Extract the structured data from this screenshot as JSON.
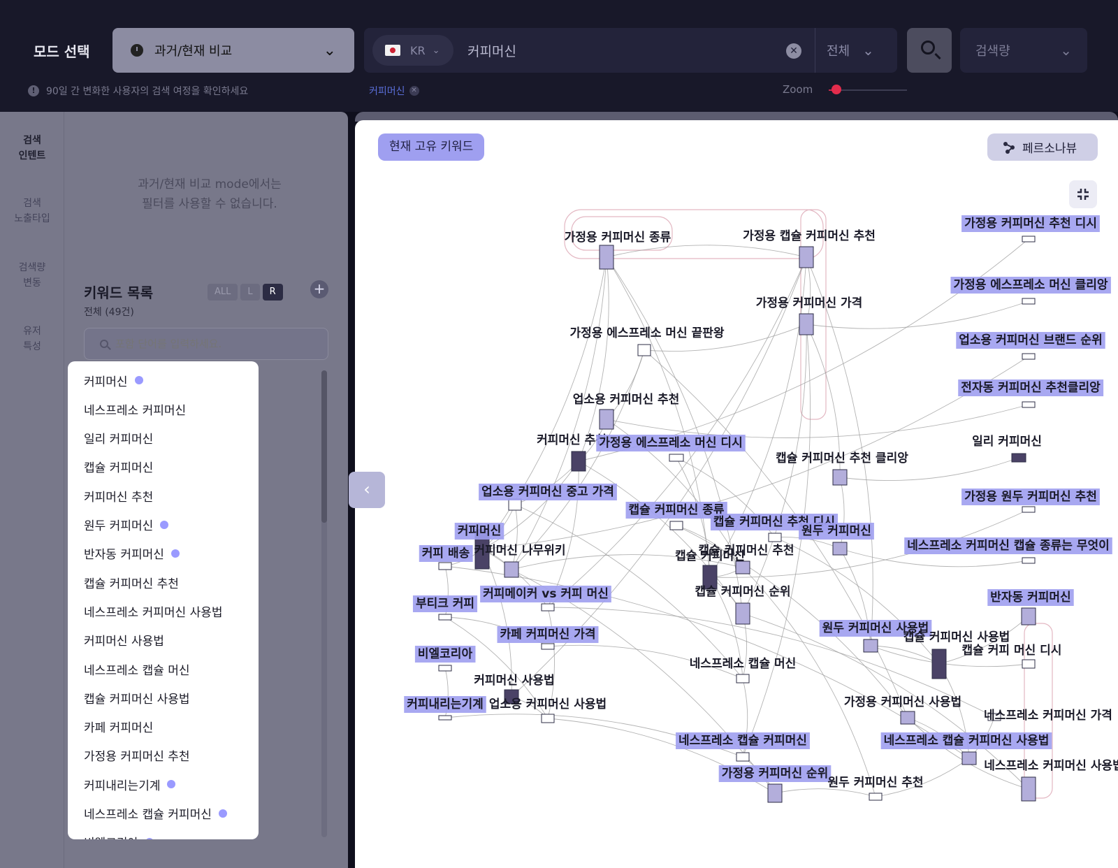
{
  "topbar": {
    "mode_label": "모드 선택",
    "mode_select": "과거/현재 비교",
    "country": "KR",
    "search_value": "커피머신",
    "scope": "전체",
    "volume": "검색량",
    "info_text": "90일 간 변화한 사용자의 검색 여정을 확인하세요",
    "tag": "커피머신",
    "zoom_label": "Zoom",
    "zoom_level": 0.1
  },
  "sidenav": [
    "검색\n인텐트",
    "검색\n노출타입",
    "검색량\n변동",
    "유저\n특성"
  ],
  "left": {
    "filter_message_1": "과거/현재 비교 mode에서는",
    "filter_message_2": "필터를 사용할 수 없습니다.",
    "keyword_title": "키워드 목록",
    "keyword_count": "전체 (49건)",
    "filters": [
      "ALL",
      "L",
      "R"
    ],
    "active_filter": "R",
    "search_placeholder": "포함 단어를 입력하세요.",
    "keywords": [
      {
        "label": "커피머신",
        "dot": true
      },
      {
        "label": "네스프레소 커피머신",
        "dot": false
      },
      {
        "label": "일리 커피머신",
        "dot": false
      },
      {
        "label": "캡슐 커피머신",
        "dot": false
      },
      {
        "label": "커피머신 추천",
        "dot": false
      },
      {
        "label": "원두 커피머신",
        "dot": true
      },
      {
        "label": "반자동 커피머신",
        "dot": true
      },
      {
        "label": "캡슐 커피머신 추천",
        "dot": false
      },
      {
        "label": "네스프레소 커피머신 사용법",
        "dot": false
      },
      {
        "label": "커피머신 사용법",
        "dot": false
      },
      {
        "label": "네스프레소 캡슐 머신",
        "dot": false
      },
      {
        "label": "캡슐 커피머신 사용법",
        "dot": false
      },
      {
        "label": "카페 커피머신",
        "dot": false
      },
      {
        "label": "가정용 커피머신 추천",
        "dot": false
      },
      {
        "label": "커피내리는기계",
        "dot": true
      },
      {
        "label": "네스프레소 캡슐 커피머신",
        "dot": true
      },
      {
        "label": "비엘코리아",
        "dot": true
      }
    ]
  },
  "graph": {
    "badge": "현재 고유 키워드",
    "persona_button": "페르소나뷰",
    "nodes": [
      {
        "label": "가정용 커피머신 추천 디시",
        "hl": true
      },
      {
        "label": "가정용 에스프레소 머신 클리앙",
        "hl": true
      },
      {
        "label": "업소용 커피머신 브랜드 순위",
        "hl": true
      },
      {
        "label": "전자동 커피머신 추천클리앙",
        "hl": true
      },
      {
        "label": "일리 커피머신",
        "hl": false
      },
      {
        "label": "가정용 원두 커피머신 추천",
        "hl": true
      },
      {
        "label": "네스프레소 커피머신 캡슐 종류는 무엇이",
        "hl": true
      },
      {
        "label": "반자동 커피머신",
        "hl": true
      },
      {
        "label": "캡슐 커피 머신 디시",
        "hl": false
      },
      {
        "label": "네스프레소 커피머신 가격",
        "hl": false
      },
      {
        "label": "네스프레소 커피머신 사용법",
        "hl": false
      },
      {
        "label": "가정용 커피머신 종류",
        "hl": false
      },
      {
        "label": "가정용 캡슐 커피머신 추천",
        "hl": false
      },
      {
        "label": "가정용 커피머신 가격",
        "hl": false
      },
      {
        "label": "가정용 에스프레소 머신 끝판왕",
        "hl": false
      },
      {
        "label": "업소용 커피머신 추천",
        "hl": false
      },
      {
        "label": "커피머신 추천",
        "hl": false
      },
      {
        "label": "가정용 에스프레소 머신 디시",
        "hl": true
      },
      {
        "label": "캡슐 커피머신 추천 클리앙",
        "hl": false
      },
      {
        "label": "업소용 커피머신 중고 가격",
        "hl": true
      },
      {
        "label": "캡슐 커피머신 종류",
        "hl": true
      },
      {
        "label": "캡슐 커피머신 추천 디시",
        "hl": true
      },
      {
        "label": "원두 커피머신",
        "hl": true
      },
      {
        "label": "커피머신",
        "hl": true
      },
      {
        "label": "커피 배송",
        "hl": true
      },
      {
        "label": "커피머신 나무위키",
        "hl": false
      },
      {
        "label": "캡슐 커피머신 추천",
        "hl": false
      },
      {
        "label": "캡슐 커피머신",
        "hl": false
      },
      {
        "label": "부티크 커피",
        "hl": true
      },
      {
        "label": "커피메이커 vs 커피 머신",
        "hl": true
      },
      {
        "label": "캡슐 커피머신 순위",
        "hl": false
      },
      {
        "label": "원두 커피머신 사용법",
        "hl": true
      },
      {
        "label": "캡슐 커피머신 사용법",
        "hl": false
      },
      {
        "label": "카페 커피머신 가격",
        "hl": true
      },
      {
        "label": "비엘코리아",
        "hl": true
      },
      {
        "label": "네스프레소 캡슐 머신",
        "hl": false
      },
      {
        "label": "커피머신 사용법",
        "hl": false
      },
      {
        "label": "커피내리는기계",
        "hl": true
      },
      {
        "label": "업소용 커피머신 사용법",
        "hl": false
      },
      {
        "label": "가정용 커피머신 사용법",
        "hl": false
      },
      {
        "label": "네스프레소 캡슐 커피머신",
        "hl": true
      },
      {
        "label": "네스프레소 캡슐 커피머신 사용법",
        "hl": true
      },
      {
        "label": "가정용 커피머신 순위",
        "hl": true
      },
      {
        "label": "원두 커피머신 추천",
        "hl": false
      }
    ]
  },
  "colors": {
    "accent": "#9f9ff0",
    "node_fill": "#b3aedb",
    "node_dark": "#4a4266",
    "edge": "#9a9a9a"
  }
}
